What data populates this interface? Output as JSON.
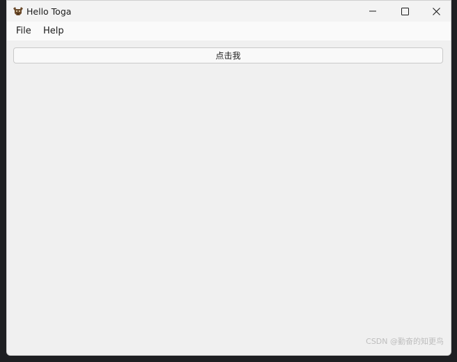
{
  "window": {
    "title": "Hello Toga",
    "icon": "toga-app-icon"
  },
  "title_controls": {
    "minimize_icon": "minimize-icon",
    "maximize_icon": "maximize-icon",
    "close_icon": "close-icon"
  },
  "menubar": {
    "items": [
      {
        "label": "File"
      },
      {
        "label": "Help"
      }
    ]
  },
  "content": {
    "button_label": "点击我"
  },
  "watermark": "CSDN @勤奋的知更鸟",
  "colors": {
    "window_bg": "#f0f0f0",
    "titlebar_bg": "#f3f3f3",
    "menubar_bg": "#fafafa",
    "desktop_bg": "#1e1f22"
  }
}
